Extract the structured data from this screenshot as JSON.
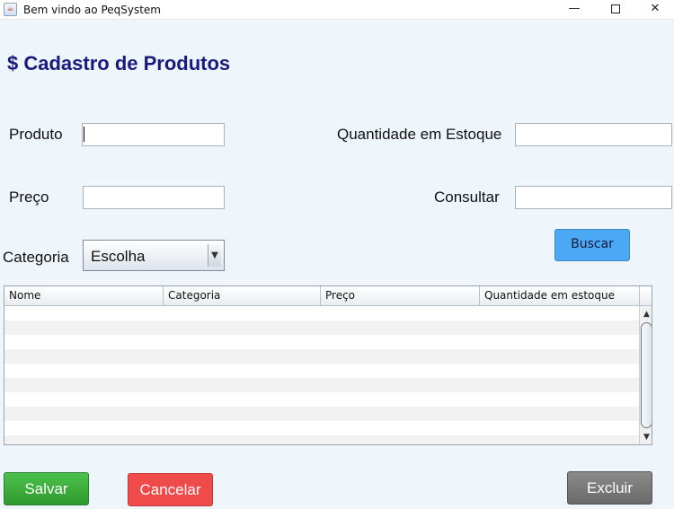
{
  "window": {
    "title": "Bem vindo ao PeqSystem",
    "app_icon_glyph": "☕",
    "min_glyph": "—",
    "close_glyph": "✕"
  },
  "page_title": "$ Cadastro de Produtos",
  "form": {
    "produto_label": "Produto",
    "produto_value": "",
    "preco_label": "Preço",
    "preco_value": "",
    "categoria_label": "Categoria",
    "categoria_selected": "Escolha",
    "quantidade_label": "Quantidade em Estoque",
    "quantidade_value": "",
    "consultar_label": "Consultar",
    "consultar_value": ""
  },
  "buttons": {
    "buscar": "Buscar",
    "salvar": "Salvar",
    "cancelar": "Cancelar",
    "excluir": "Excluir"
  },
  "table": {
    "columns": [
      "Nome",
      "Categoria",
      "Preço",
      "Quantidade em estoque"
    ],
    "rows": []
  },
  "colors": {
    "title": "#1a1a7e",
    "buscar": "#4aa8f5",
    "salvar": "#3aae3a",
    "cancelar": "#f04b4b",
    "excluir": "#7a7a7a"
  },
  "icons": {
    "dropdown_arrow": "▼",
    "scroll_up": "▲",
    "scroll_down": "▼"
  }
}
